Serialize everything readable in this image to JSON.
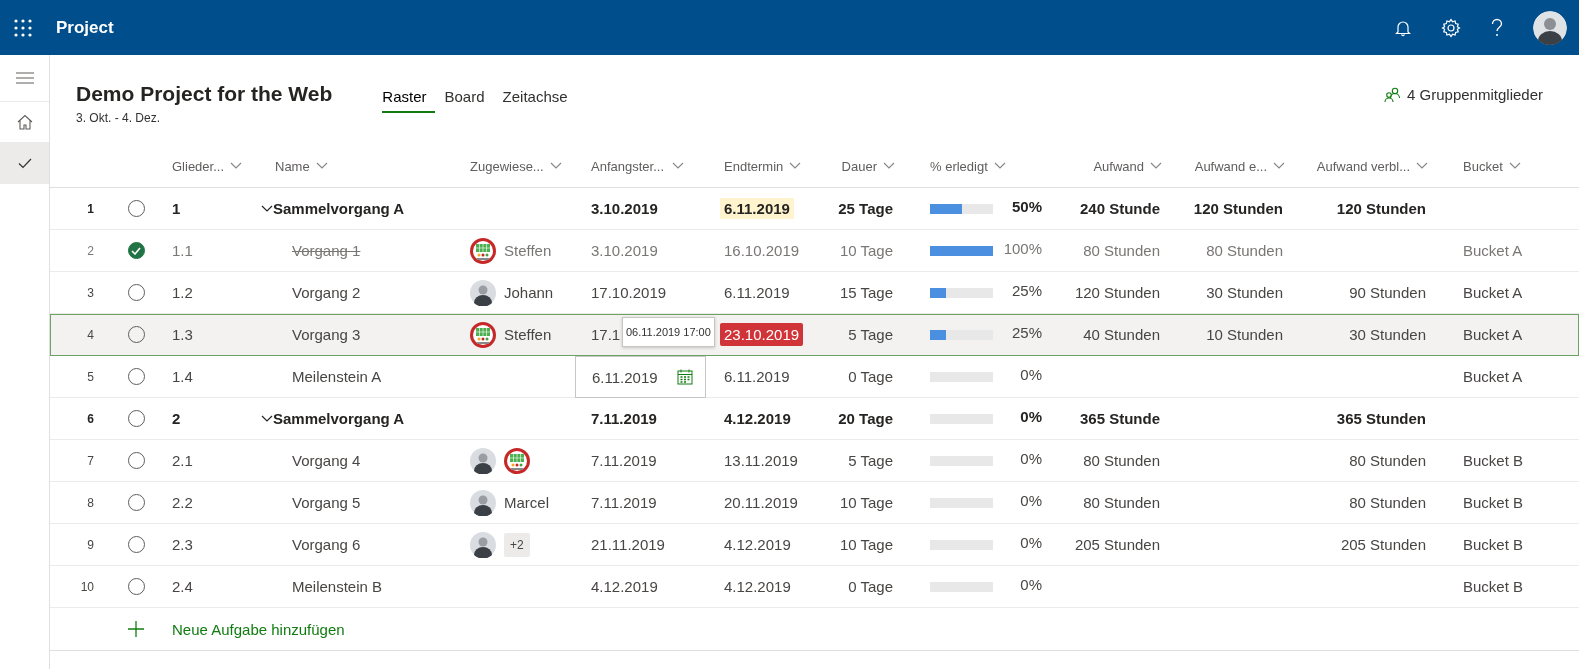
{
  "app": {
    "title": "Project"
  },
  "sidebar": {
    "items": [
      {
        "kind": "menu",
        "selected": false
      },
      {
        "kind": "home",
        "selected": false
      },
      {
        "kind": "tasks",
        "selected": true
      }
    ]
  },
  "project": {
    "title": "Demo Project for the Web",
    "dates": "3. Okt. - 4. Dez.",
    "members": "4 Gruppenmitglieder"
  },
  "tabs": [
    {
      "label": "Raster",
      "selected": true
    },
    {
      "label": "Board",
      "selected": false
    },
    {
      "label": "Zeitachse",
      "selected": false
    }
  ],
  "columns": [
    "Glieder...",
    "Name",
    "Zugewiese...",
    "Anfangster...",
    "Endtermin",
    "Dauer",
    "% erledigt",
    "Aufwand",
    "Aufwand e...",
    "Aufwand verbl...",
    "Bucket"
  ],
  "rows": [
    {
      "num": "1",
      "done": false,
      "outline": "1",
      "kind": "summary",
      "expanded": true,
      "name": "Sammelvorgang A",
      "assignees": [],
      "start": "3.10.2019",
      "start_editing": false,
      "end": "6.11.2019",
      "end_warning": true,
      "overdue": false,
      "duration": "25 Tage",
      "level": 0.5,
      "pct": "50%",
      "work": "240 Stunde",
      "work_done": "120 Stunden",
      "work_left": "120 Stunden",
      "selected": false
    },
    {
      "num": "2",
      "done": true,
      "outline": "1.1",
      "kind": "task",
      "name": "Vorgang 1",
      "assignees": [
        {
          "kind": "team",
          "name": "Steffen"
        }
      ],
      "start": "3.10.2019",
      "start_editing": false,
      "end": "16.10.2019",
      "end_warning": false,
      "overdue": false,
      "duration": "10 Tage",
      "level": 1,
      "pct": "100%",
      "work": "80 Stunden",
      "work_done": "80 Stunden",
      "bucket": "Bucket A",
      "selected": false
    },
    {
      "num": "3",
      "done": false,
      "outline": "1.2",
      "kind": "task",
      "name": "Vorgang 2",
      "assignees": [
        {
          "kind": "person",
          "name": "Johann"
        }
      ],
      "start": "17.10.2019",
      "start_editing": false,
      "end": "6.11.2019",
      "end_warning": false,
      "overdue": false,
      "duration": "15 Tage",
      "level": 0.25,
      "pct": "25%",
      "work": "120 Stunden",
      "work_done": "30 Stunden",
      "work_left": "90 Stunden",
      "bucket": "Bucket A",
      "selected": false
    },
    {
      "num": "4",
      "done": false,
      "outline": "1.3",
      "kind": "task",
      "name": "Vorgang 3",
      "assignees": [
        {
          "kind": "team",
          "name": "Steffen"
        }
      ],
      "start": "17.1",
      "tooltip": "06.11.2019 17:00",
      "start_editing": false,
      "end": "23.10.2019",
      "end_warning": false,
      "overdue": true,
      "duration": "5 Tage",
      "level": 0.25,
      "pct": "25%",
      "work": "40 Stunden",
      "work_done": "10 Stunden",
      "work_left": "30 Stunden",
      "bucket": "Bucket A",
      "selected": true
    },
    {
      "num": "5",
      "done": false,
      "outline": "1.4",
      "kind": "task",
      "name": "Meilenstein A",
      "assignees": [],
      "start": "6.11.2019",
      "start_editing": true,
      "end": "6.11.2019",
      "end_warning": false,
      "overdue": false,
      "duration": "0 Tage",
      "level": 0,
      "pct": "0%",
      "bucket": "Bucket A",
      "selected": false
    },
    {
      "num": "6",
      "done": false,
      "outline": "2",
      "kind": "summary",
      "expanded": true,
      "name": "Sammelvorgang A",
      "assignees": [],
      "start": "7.11.2019",
      "start_editing": false,
      "end": "4.12.2019",
      "end_warning": false,
      "overdue": false,
      "duration": "20 Tage",
      "level": 0,
      "pct": "0%",
      "work": "365 Stunde",
      "work_left": "365 Stunden",
      "selected": false
    },
    {
      "num": "7",
      "done": false,
      "outline": "2.1",
      "kind": "task",
      "name": "Vorgang 4",
      "assignees": [
        {
          "kind": "person"
        },
        {
          "kind": "team"
        }
      ],
      "start": "7.11.2019",
      "start_editing": false,
      "end": "13.11.2019",
      "end_warning": false,
      "overdue": false,
      "duration": "5 Tage",
      "level": 0,
      "pct": "0%",
      "work": "80 Stunden",
      "work_left": "80 Stunden",
      "bucket": "Bucket B",
      "selected": false
    },
    {
      "num": "8",
      "done": false,
      "outline": "2.2",
      "kind": "task",
      "name": "Vorgang 5",
      "assignees": [
        {
          "kind": "person",
          "name": "Marcel"
        }
      ],
      "start": "7.11.2019",
      "start_editing": false,
      "end": "20.11.2019",
      "end_warning": false,
      "overdue": false,
      "duration": "10 Tage",
      "level": 0,
      "pct": "0%",
      "work": "80 Stunden",
      "work_left": "80 Stunden",
      "bucket": "Bucket B",
      "selected": false
    },
    {
      "num": "9",
      "done": false,
      "outline": "2.3",
      "kind": "task",
      "name": "Vorgang 6",
      "assignees": [
        {
          "kind": "person"
        },
        {
          "kind": "more",
          "label": "+2"
        }
      ],
      "start": "21.11.2019",
      "start_editing": false,
      "end": "4.12.2019",
      "end_warning": false,
      "overdue": false,
      "duration": "10 Tage",
      "level": 0,
      "pct": "0%",
      "work": "205 Stunden",
      "work_left": "205 Stunden",
      "bucket": "Bucket B",
      "selected": false
    },
    {
      "num": "10",
      "done": false,
      "outline": "2.4",
      "kind": "task",
      "name": "Meilenstein B",
      "assignees": [],
      "start": "4.12.2019",
      "start_editing": false,
      "end": "4.12.2019",
      "end_warning": false,
      "overdue": false,
      "duration": "0 Tage",
      "level": 0,
      "pct": "0%",
      "bucket": "Bucket B",
      "selected": false
    }
  ],
  "add_task": {
    "label": "Neue Aufgabe hinzufügen"
  }
}
